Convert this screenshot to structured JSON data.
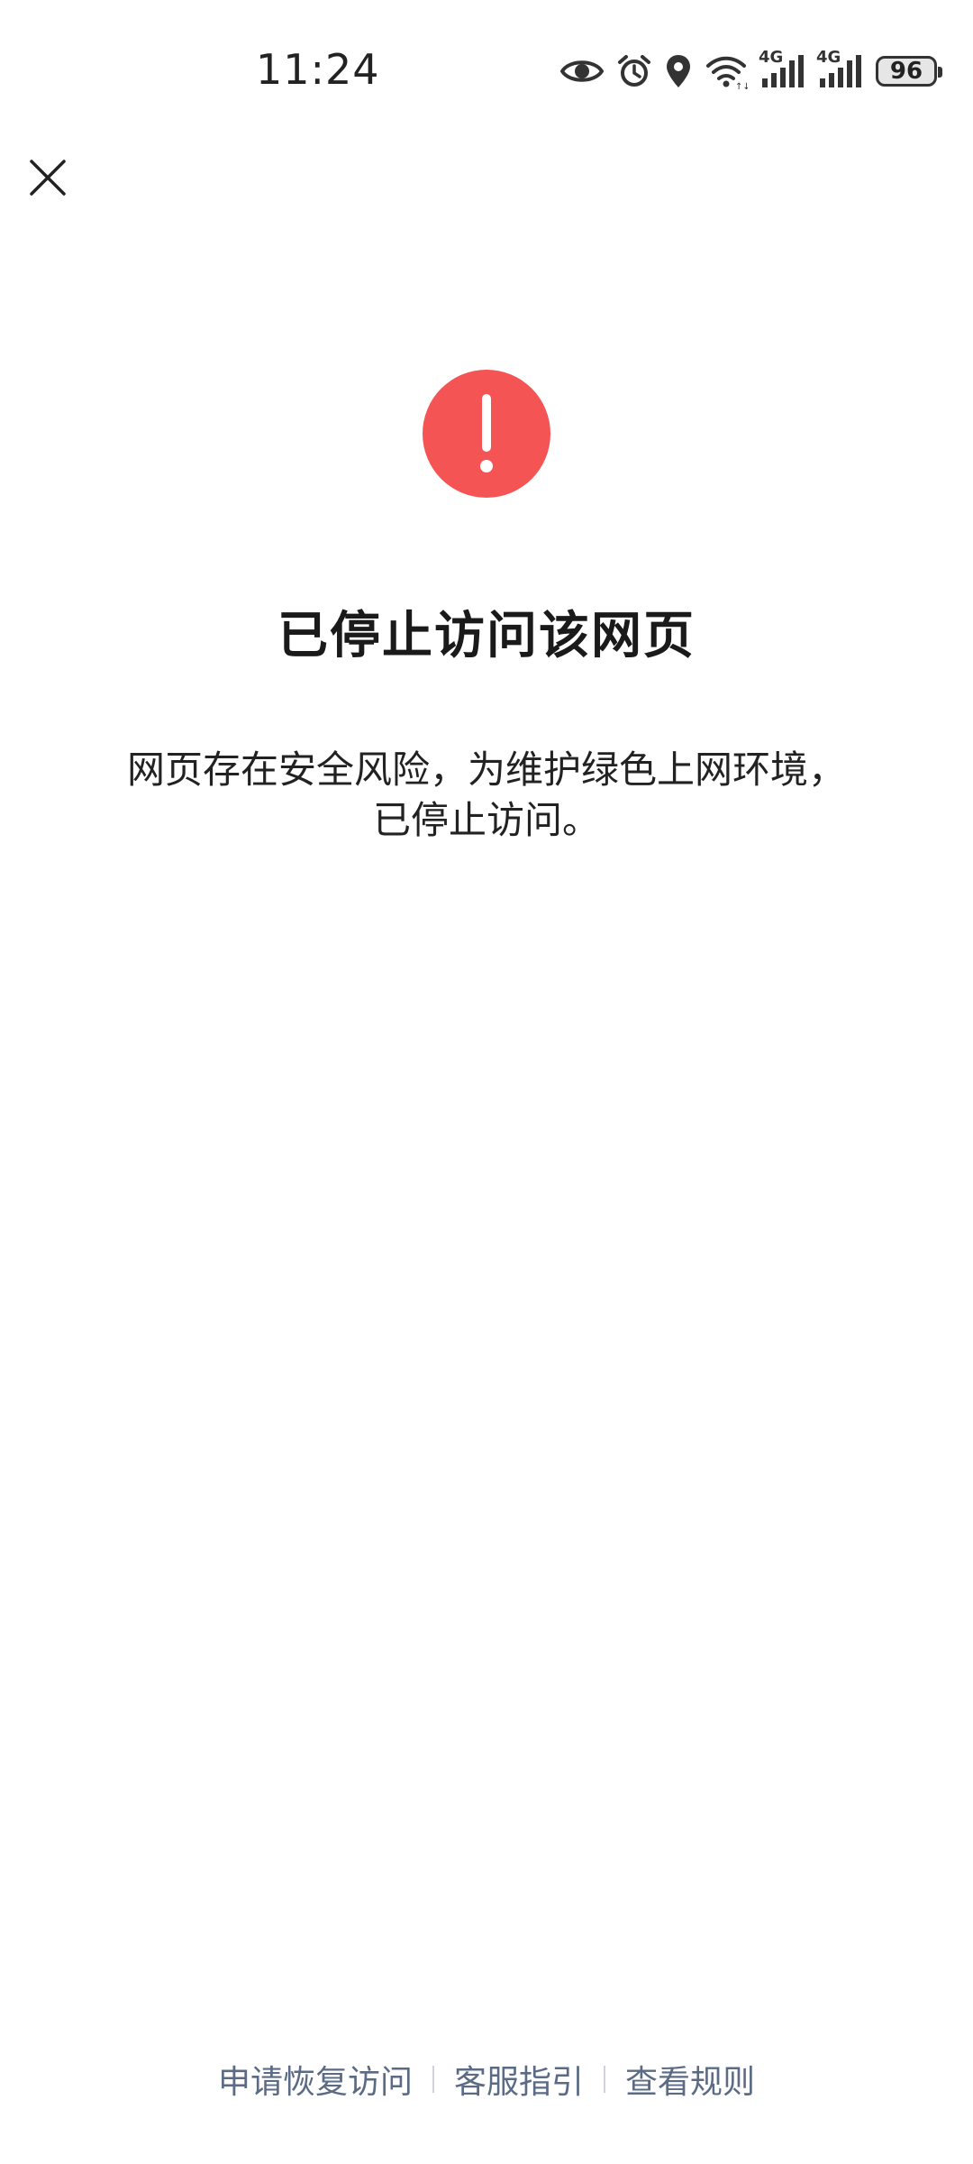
{
  "status_bar": {
    "time": "11:24",
    "network_1": "4G",
    "network_2": "4G",
    "battery": "96",
    "icons": [
      "eye-icon",
      "alarm-icon",
      "location-icon",
      "wifi-icon",
      "signal-icon",
      "signal-icon",
      "battery-icon"
    ]
  },
  "close_icon": "close-icon",
  "warning": {
    "icon": "exclamation-icon",
    "color": "#f55454"
  },
  "title": "已停止访问该网页",
  "description": {
    "line1": "网页存在安全风险，为维护绿色上网环境，",
    "line2": "已停止访问。"
  },
  "footer": {
    "links": [
      "申请恢复访问",
      "客服指引",
      "查看规则"
    ],
    "link_color": "#5b6b85"
  }
}
